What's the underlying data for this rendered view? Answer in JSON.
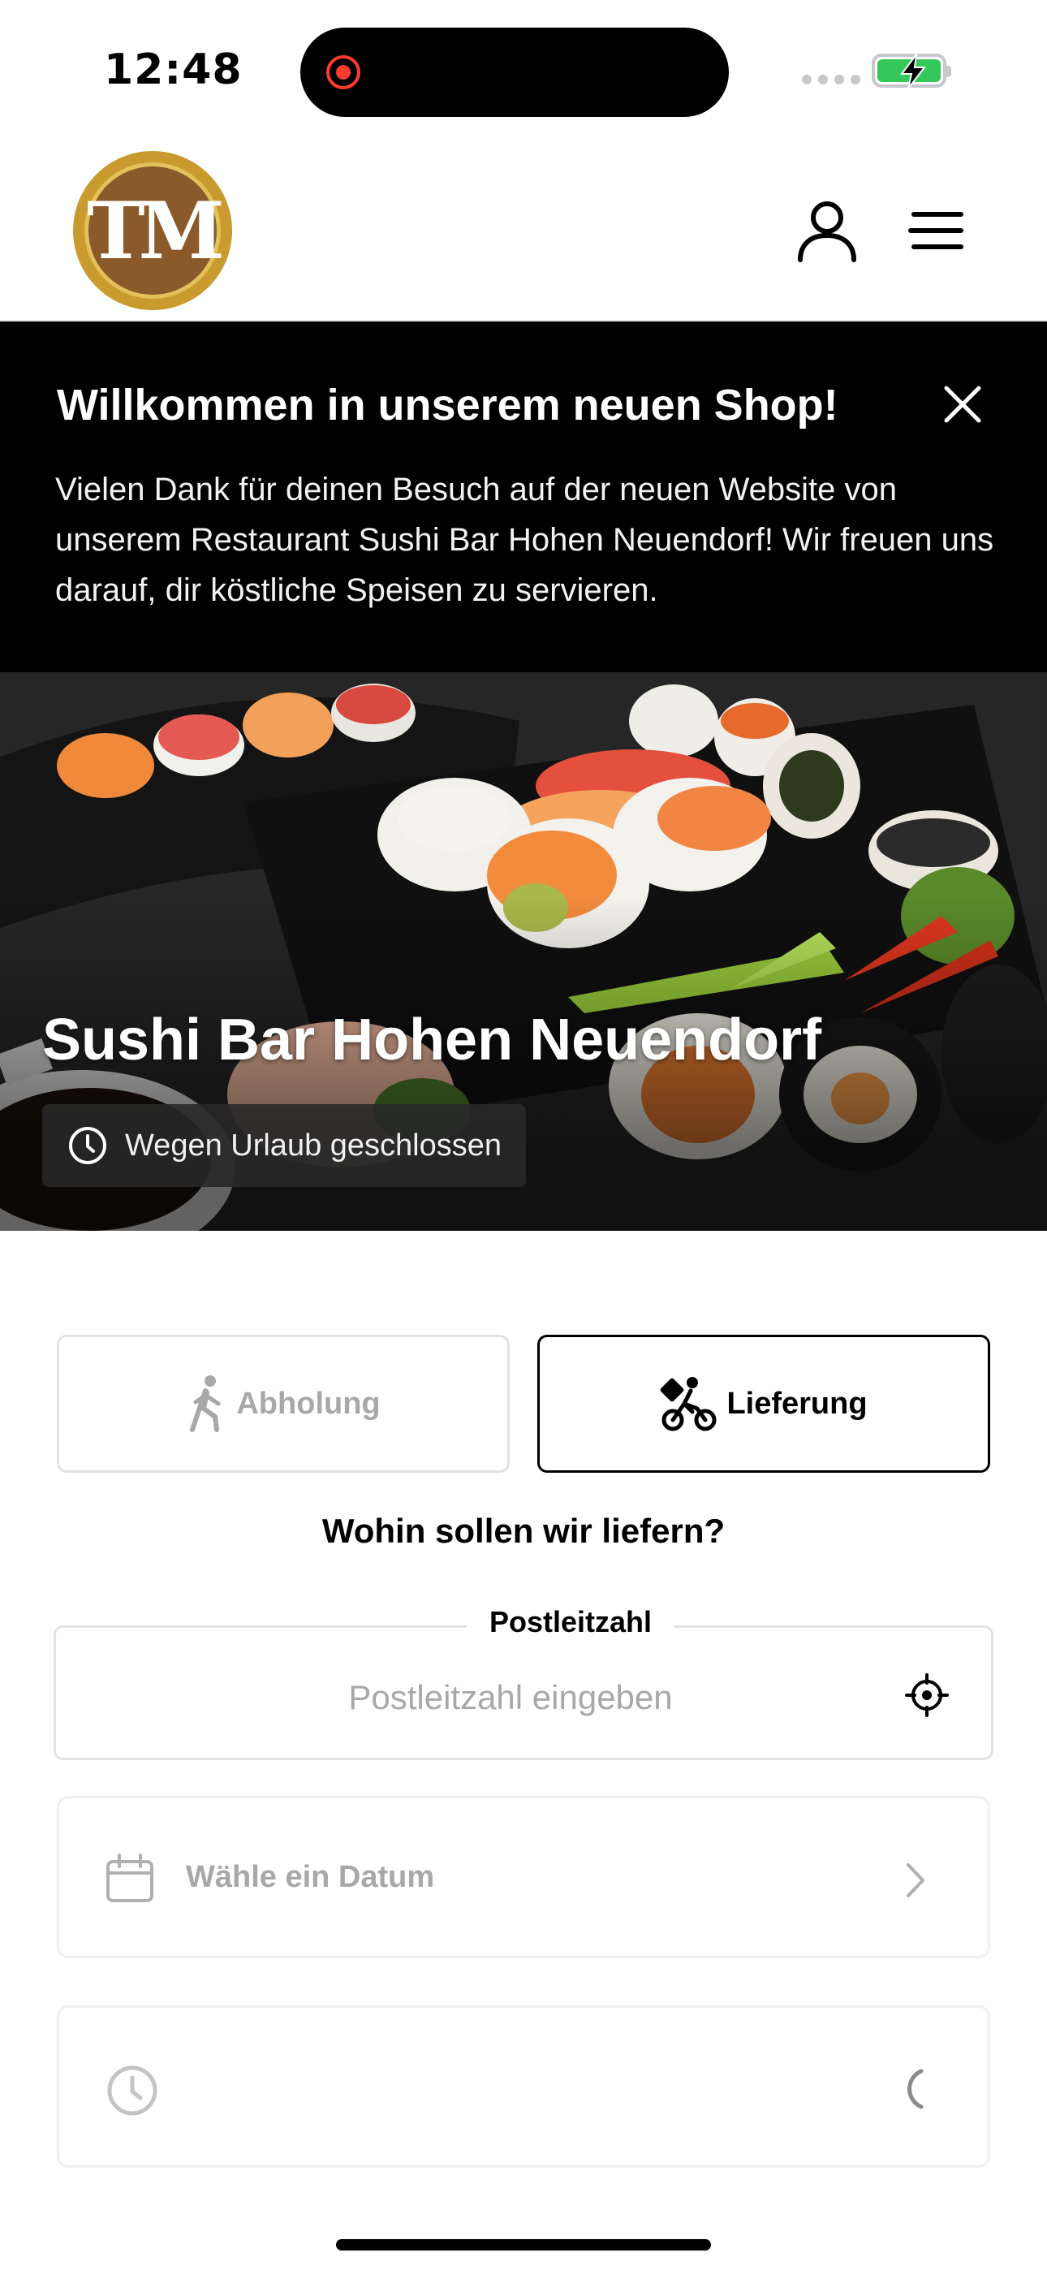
{
  "status_bar": {
    "time": "12:48"
  },
  "header": {
    "logo_text": "TM",
    "icons": [
      "user-icon",
      "menu-icon"
    ]
  },
  "banner": {
    "title": "Willkommen in unserem neuen Shop!",
    "text": "Vielen Dank für deinen Besuch auf der neuen Website von unserem Restaurant Sushi Bar Hohen Neuendorf! Wir freuen uns darauf, dir köstliche Speisen zu servieren."
  },
  "hero": {
    "restaurant_name": "Sushi Bar Hohen Neuendorf",
    "opening_status": "Wegen Urlaub geschlossen"
  },
  "order_mode": {
    "pickup_label": "Abholung",
    "delivery_label": "Lieferung",
    "selected": "Lieferung"
  },
  "delivery": {
    "question": "Wohin sollen wir liefern?",
    "postal_label": "Postleitzahl",
    "postal_placeholder": "Postleitzahl eingeben",
    "postal_value": ""
  },
  "date_picker": {
    "label": "Wähle ein Datum"
  },
  "time_picker": {
    "label": ""
  },
  "colors": {
    "banner_bg": "#000000",
    "selected_border": "#000000",
    "muted_text": "#a8a8a8",
    "logo_gold": "#c99a2e",
    "logo_brown": "#8a5a2b",
    "battery_green": "#34c759",
    "record_red": "#ff3b30"
  }
}
